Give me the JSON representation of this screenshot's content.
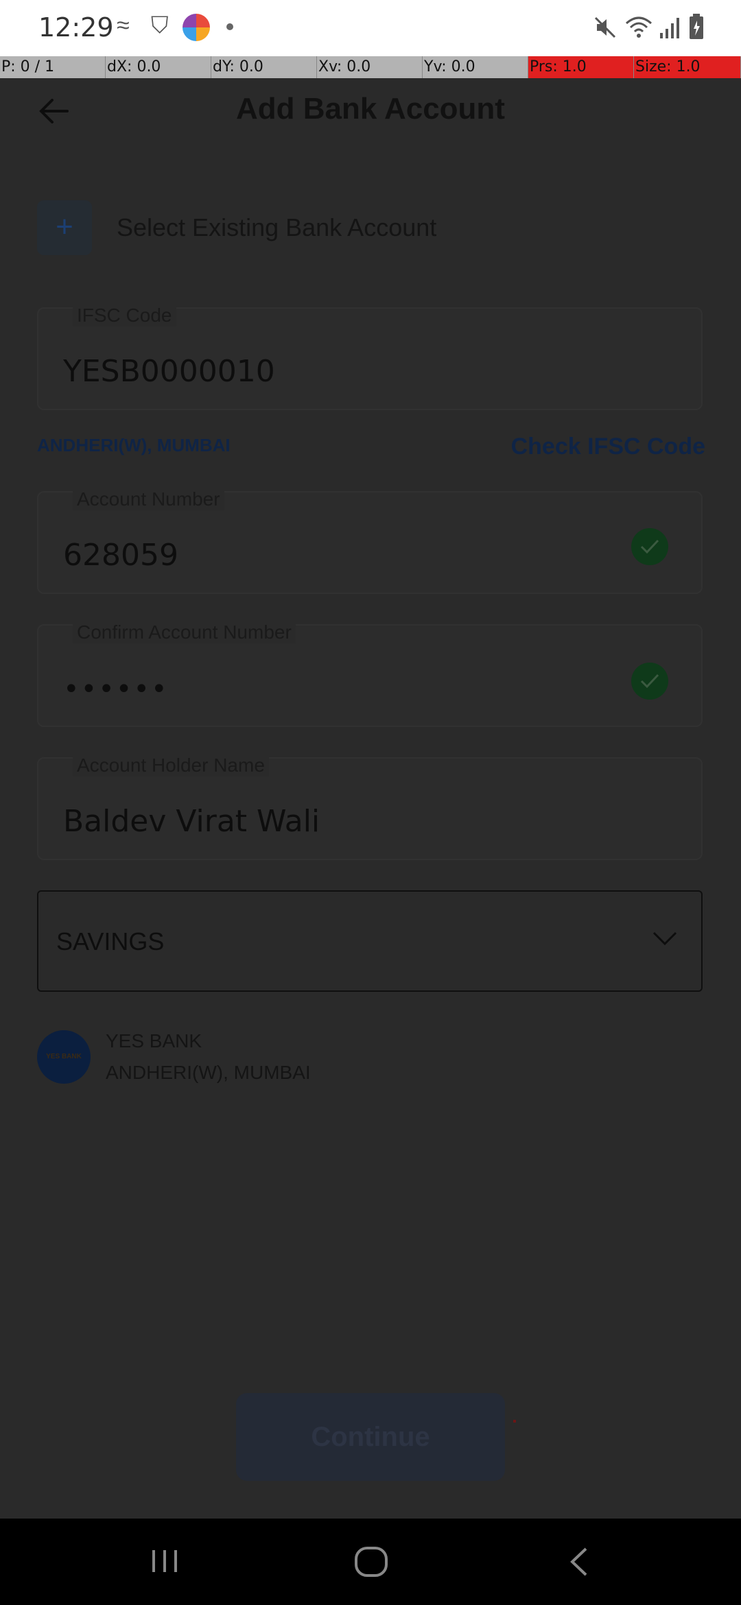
{
  "status_bar": {
    "time": "12:29",
    "icons": [
      "rapido-icon",
      "vpn-icon",
      "app-icon",
      "dot",
      "mute-icon",
      "wifi-icon",
      "signal-icon",
      "battery-icon"
    ]
  },
  "debug_overlay": {
    "p": "P: 0 / 1",
    "dx": "dX: 0.0",
    "dy": "dY: 0.0",
    "xv": "Xv: 0.0",
    "yv": "Yv: 0.0",
    "prs": "Prs: 1.0",
    "size": "Size: 1.0"
  },
  "header": {
    "title": "Add Bank Account"
  },
  "select_existing": {
    "label": "Select Existing Bank Account"
  },
  "form": {
    "ifsc": {
      "label": "IFSC Code",
      "value": "YESB0000010"
    },
    "branch_hint": "ANDHERI(W), MUMBAI",
    "check_ifsc_link": "Check IFSC Code",
    "account_number": {
      "label": "Account Number",
      "value": "628059"
    },
    "confirm_account_number": {
      "label": "Confirm Account Number",
      "value": "••••••"
    },
    "account_holder": {
      "label": "Account Holder Name",
      "value": "Baldev Virat Wali"
    },
    "account_type": {
      "value": "SAVINGS"
    }
  },
  "bank_info": {
    "logo_text": "YES BANK",
    "name": "YES BANK",
    "branch": "ANDHERI(W), MUMBAI"
  },
  "continue_label": "Continue",
  "colors": {
    "overlay_bg": "#2a2a2a",
    "link": "#0f2446",
    "check": "#0f3a1a"
  }
}
